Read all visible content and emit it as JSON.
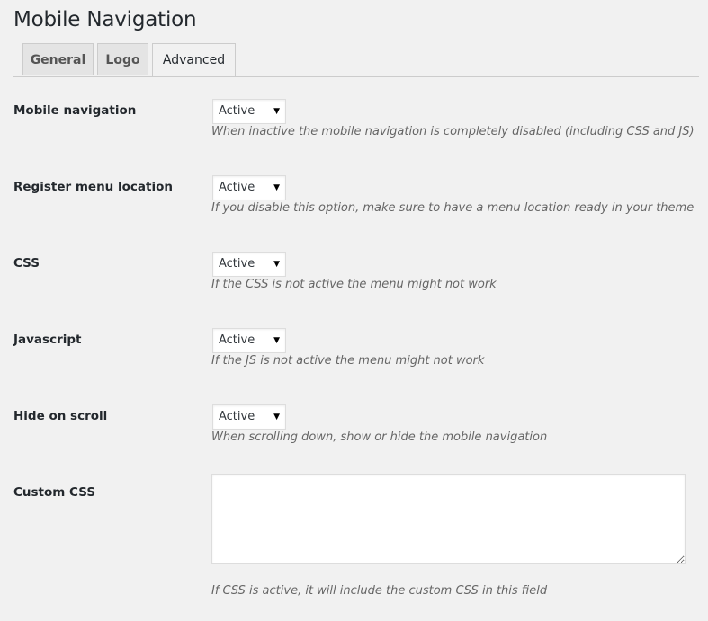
{
  "page": {
    "title": "Mobile Navigation"
  },
  "tabs": [
    {
      "label": "General",
      "active": false
    },
    {
      "label": "Logo",
      "active": false
    },
    {
      "label": "Advanced",
      "active": true
    }
  ],
  "settings": [
    {
      "label": "Mobile navigation",
      "value": "Active",
      "description": "When inactive the mobile navigation is completely disabled (including CSS and JS)"
    },
    {
      "label": "Register menu location",
      "value": "Active",
      "description": "If you disable this option, make sure to have a menu location ready in your theme"
    },
    {
      "label": "CSS",
      "value": "Active",
      "description": "If the CSS is not active the menu might not work"
    },
    {
      "label": "Javascript",
      "value": "Active",
      "description": "If the JS is not active the menu might not work"
    },
    {
      "label": "Hide on scroll",
      "value": "Active",
      "description": "When scrolling down, show or hide the mobile navigation"
    }
  ],
  "custom_css": {
    "label": "Custom CSS",
    "value": "",
    "description": "If CSS is active, it will include the custom CSS in this field"
  },
  "icons": {
    "dropdown_arrow": "▼"
  }
}
